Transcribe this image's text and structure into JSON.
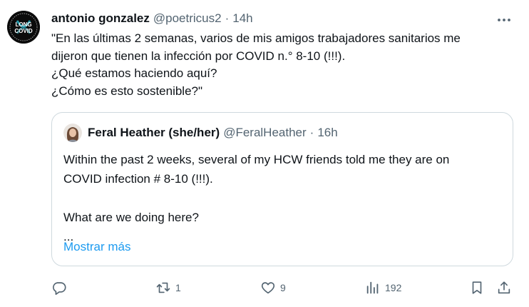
{
  "tweet": {
    "author_name": "antonio gonzalez",
    "author_handle": "@poetricus2",
    "separator": "·",
    "time": "14h",
    "avatar_text": [
      "LONG",
      "COVID"
    ],
    "text_lines": [
      "\"En las últimas 2 semanas, varios de mis amigos trabajadores sanitarios me",
      "dijeron que tienen la infección por COVID n.° 8-10 (!!!).",
      "¿Qué estamos haciendo aquí?",
      "¿Cómo es esto sostenible?\""
    ],
    "more_icon": "ellipsis-icon"
  },
  "quote": {
    "author_name": "Feral Heather (she/her)",
    "author_handle": "@FeralHeather",
    "separator": "·",
    "time": "16h",
    "text_lines": [
      "Within the past 2 weeks, several of my HCW friends told me they are on",
      "COVID infection # 8-10 (!!!).",
      "",
      "What are we doing here?",
      "..."
    ],
    "show_more": "Mostrar más"
  },
  "actions": {
    "reply": {
      "icon": "reply-icon",
      "count": ""
    },
    "retweet": {
      "icon": "retweet-icon",
      "count": "1"
    },
    "like": {
      "icon": "heart-icon",
      "count": "9"
    },
    "views": {
      "icon": "views-icon",
      "count": "192"
    },
    "bookmark": {
      "icon": "bookmark-icon",
      "count": ""
    },
    "share": {
      "icon": "share-icon",
      "count": ""
    }
  },
  "colors": {
    "text": "#0f1419",
    "secondary": "#536471",
    "link": "#1d9bf0",
    "border": "#cfd9de",
    "avatar_ribbon": "#2ab4c8"
  }
}
